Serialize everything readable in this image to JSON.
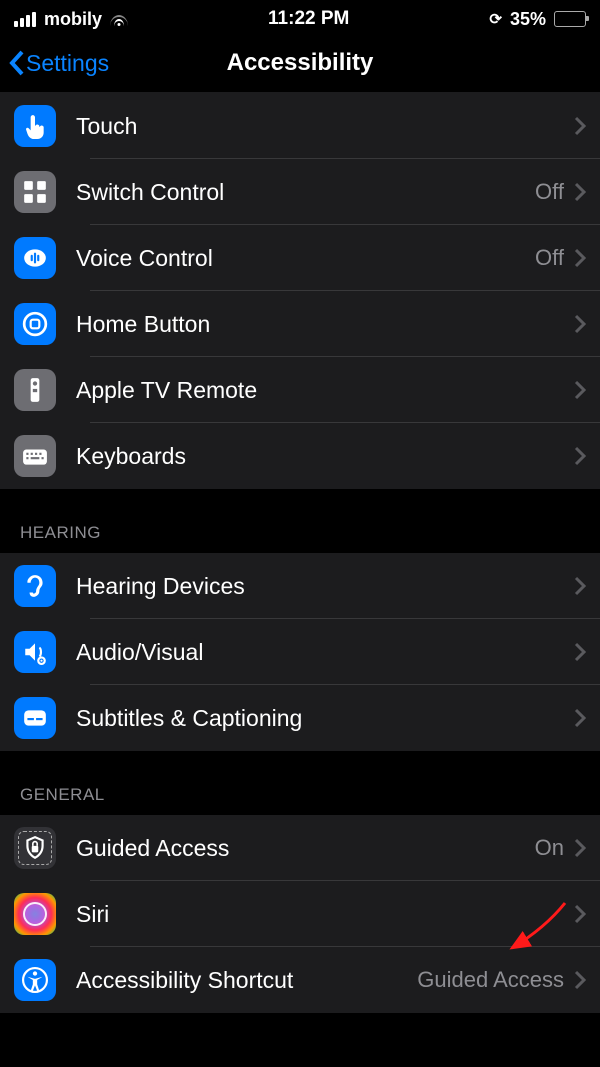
{
  "status": {
    "carrier": "mobily",
    "time": "11:22 PM",
    "battery_pct": "35%",
    "battery_fill": 35
  },
  "nav": {
    "back_label": "Settings",
    "title": "Accessibility"
  },
  "sections": [
    {
      "header": null,
      "rows": [
        {
          "icon": "touch-icon",
          "icon_bg": "blue",
          "label": "Touch",
          "value": null
        },
        {
          "icon": "switch-icon",
          "icon_bg": "gray",
          "label": "Switch Control",
          "value": "Off"
        },
        {
          "icon": "voice-icon",
          "icon_bg": "blue",
          "label": "Voice Control",
          "value": "Off"
        },
        {
          "icon": "home-button-icon",
          "icon_bg": "blue",
          "label": "Home Button",
          "value": null
        },
        {
          "icon": "remote-icon",
          "icon_bg": "gray",
          "label": "Apple TV Remote",
          "value": null
        },
        {
          "icon": "keyboard-icon",
          "icon_bg": "gray",
          "label": "Keyboards",
          "value": null
        }
      ]
    },
    {
      "header": "HEARING",
      "rows": [
        {
          "icon": "ear-icon",
          "icon_bg": "blue",
          "label": "Hearing Devices",
          "value": null
        },
        {
          "icon": "av-icon",
          "icon_bg": "blue",
          "label": "Audio/Visual",
          "value": null
        },
        {
          "icon": "captions-icon",
          "icon_bg": "blue",
          "label": "Subtitles & Captioning",
          "value": null
        }
      ]
    },
    {
      "header": "GENERAL",
      "rows": [
        {
          "icon": "guided-icon",
          "icon_bg": "dash",
          "label": "Guided Access",
          "value": "On"
        },
        {
          "icon": "siri-icon",
          "icon_bg": "siri",
          "label": "Siri",
          "value": null
        },
        {
          "icon": "a11y-icon",
          "icon_bg": "blue",
          "label": "Accessibility Shortcut",
          "value": "Guided Access"
        }
      ]
    }
  ]
}
